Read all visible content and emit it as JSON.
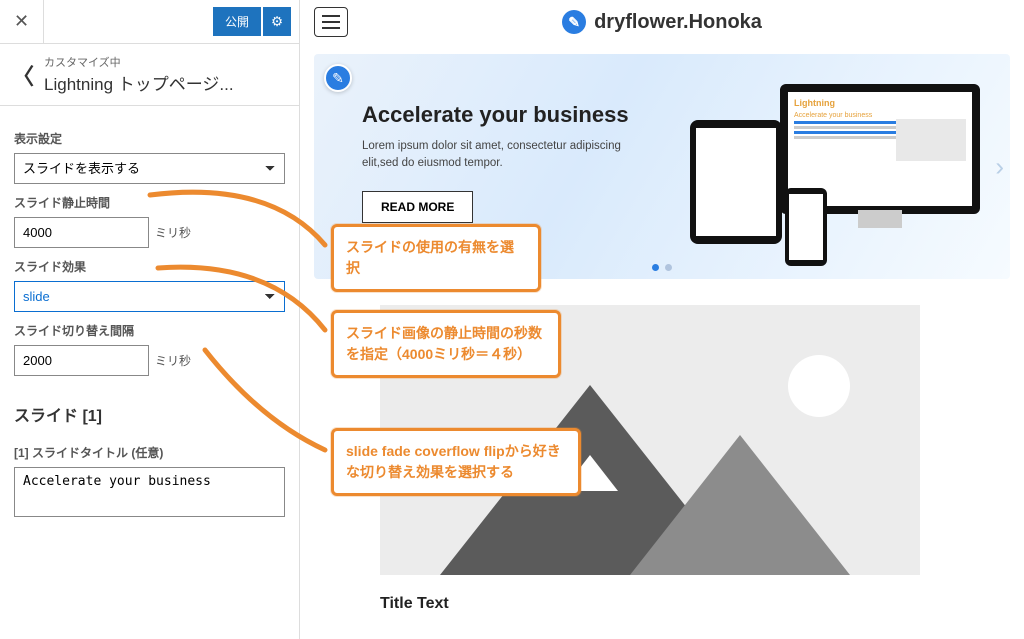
{
  "colors": {
    "accent": "#2a7de1",
    "annotation": "#ec8a2f"
  },
  "sidebar": {
    "publish_label": "公開",
    "subheading": "カスタマイズ中",
    "title": "Lightning トップページ...",
    "display_setting_label": "表示設定",
    "display_setting_value": "スライドを表示する",
    "pause_label": "スライド静止時間",
    "pause_value": "4000",
    "pause_unit": "ミリ秒",
    "effect_label": "スライド効果",
    "effect_value": "slide",
    "interval_label": "スライド切り替え間隔",
    "interval_value": "2000",
    "interval_unit": "ミリ秒",
    "section_title": "スライド [1]",
    "slide_title_label": "[1] スライドタイトル (任意)",
    "slide_title_value": "Accelerate your business"
  },
  "preview": {
    "brand": "dryflower.Honoka",
    "hero_title": "Accelerate your business",
    "hero_body": "Lorem ipsum dolor sit amet, consectetur adipiscing elit,sed do eiusmod tempor.",
    "hero_button": "READ MORE",
    "monitor_label": "Lightning",
    "monitor_sub": "Accelerate your business",
    "title_text": "Title Text"
  },
  "annotations": {
    "a1": "スライドの使用の有無を選択",
    "a2": "スライド画像の静止時間の秒数を指定（4000ミリ秒＝４秒）",
    "a3": "slide fade coverflow flipから好きな切り替え効果を選択する"
  }
}
